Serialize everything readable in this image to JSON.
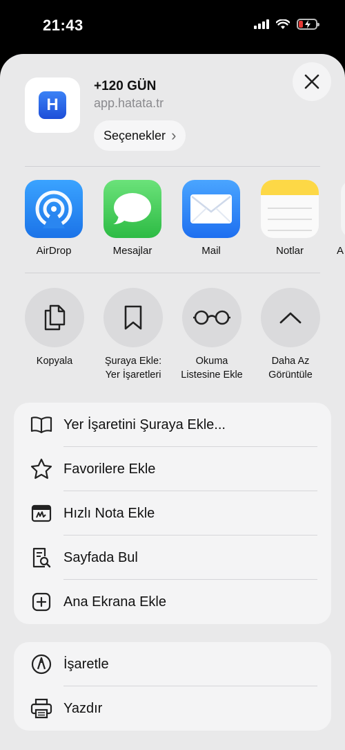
{
  "status_bar": {
    "time": "21:43"
  },
  "header": {
    "title": "+120 GÜN",
    "subtitle": "app.hatata.tr",
    "app_icon_letter": "H",
    "options_label": "Seçenekler",
    "options_chevron": "›"
  },
  "share_targets": [
    {
      "label": "AirDrop",
      "icon": "airdrop-icon"
    },
    {
      "label": "Mesajlar",
      "icon": "messages-icon"
    },
    {
      "label": "Mail",
      "icon": "mail-icon"
    },
    {
      "label": "Notlar",
      "icon": "notes-icon"
    },
    {
      "label": "A",
      "icon": "more-app-icon"
    }
  ],
  "actions": [
    {
      "label": "Kopyala",
      "icon": "copy-icon"
    },
    {
      "label": "Şuraya Ekle:\nYer İşaretleri",
      "icon": "bookmark-icon"
    },
    {
      "label": "Okuma\nListesine Ekle",
      "icon": "glasses-icon"
    },
    {
      "label": "Daha Az\nGörüntüle",
      "icon": "chevron-up-icon"
    }
  ],
  "menu1": [
    {
      "label": "Yer İşaretini Şuraya Ekle...",
      "icon": "book-icon"
    },
    {
      "label": "Favorilere Ekle",
      "icon": "star-icon"
    },
    {
      "label": "Hızlı Nota Ekle",
      "icon": "quick-note-icon"
    },
    {
      "label": "Sayfada Bul",
      "icon": "find-in-page-icon"
    },
    {
      "label": "Ana Ekrana Ekle",
      "icon": "add-square-icon"
    }
  ],
  "menu2": [
    {
      "label": "İşaretle",
      "icon": "markup-icon"
    },
    {
      "label": "Yazdır",
      "icon": "printer-icon"
    }
  ],
  "colors": {
    "sheet_bg": "#e9e9ea",
    "menu_bg": "#f4f4f5",
    "accent_blue": "#1b73e8",
    "battery_low": "#e53935"
  }
}
